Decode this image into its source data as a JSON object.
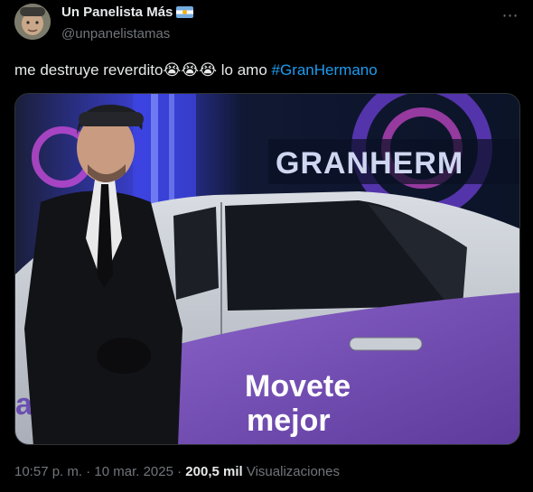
{
  "author": {
    "display_name": "Un Panelista Más",
    "handle": "@unpanelistamas",
    "flag_icon": "argentina-flag-icon"
  },
  "tweet": {
    "text_before": "me destruye reverdito",
    "emojis": [
      "😭",
      "😭",
      "😭"
    ],
    "text_after": " lo amo ",
    "hashtag": "#GranHermano"
  },
  "media": {
    "sign_text": "GRANHERM",
    "car_text_line1": "Movete",
    "car_text_line2": "mejor",
    "car_brand_partial": "ab"
  },
  "meta": {
    "time": "10:57 p. m.",
    "separator": "·",
    "date": "10 mar. 2025",
    "views_count": "200,5 mil",
    "views_label": "Visualizaciones"
  },
  "colors": {
    "background": "#000000",
    "text": "#e7e9ea",
    "muted": "#71767b",
    "link": "#1d9bf0"
  }
}
